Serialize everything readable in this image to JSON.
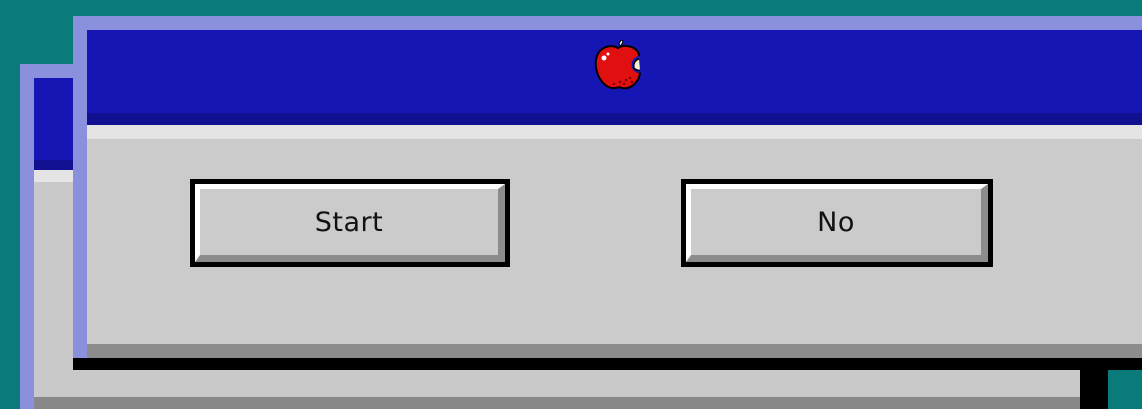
{
  "desktop": {
    "background_color": "#0a7a7a"
  },
  "dialog": {
    "title_icon": "apple-icon",
    "titlebar_color": "#1616b4",
    "buttons": {
      "start_label": "Start",
      "no_label": "No"
    }
  },
  "back_window": {
    "titlebar_color": "#1616b4"
  }
}
